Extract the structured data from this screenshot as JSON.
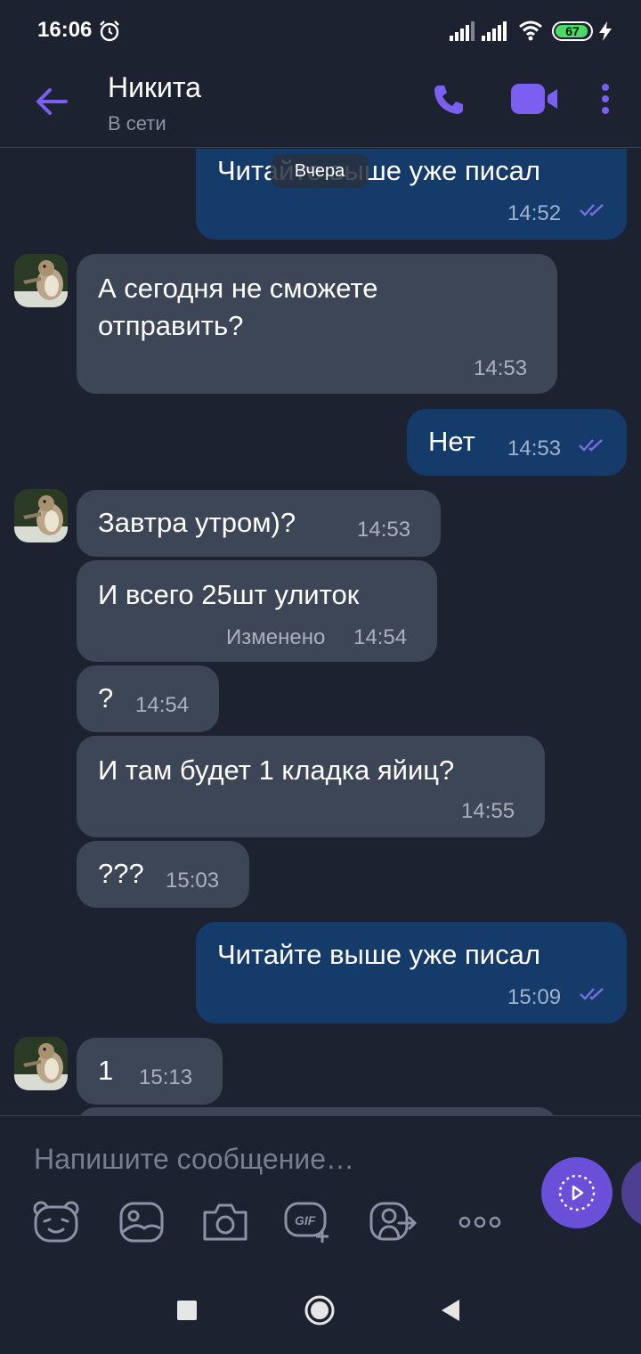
{
  "status_bar": {
    "time": "16:06",
    "battery": "67",
    "icons": [
      "alarm-icon",
      "signal-icon",
      "signal-icon",
      "wifi-icon",
      "battery-icon",
      "charging-bolt-icon"
    ]
  },
  "header": {
    "name": "Никита",
    "status": "В сети",
    "icons": [
      "back-arrow-icon",
      "phone-call-icon",
      "video-call-icon",
      "more-vertical-icon"
    ]
  },
  "date_separator": "Вчера",
  "messages": [
    {
      "dir": "out",
      "text": "Читайте выше уже писал",
      "time": "14:52",
      "read": true
    },
    {
      "dir": "in",
      "avatar": true,
      "line1": "А сегодня не сможете",
      "line2": "отправить?",
      "time": "14:53"
    },
    {
      "dir": "out",
      "text": "Нет",
      "time": "14:53",
      "read": true
    },
    {
      "dir": "in",
      "avatar": true,
      "text": "Завтра утром)?",
      "time": "14:53"
    },
    {
      "dir": "in",
      "text": "И всего 25шт улиток",
      "edited": "Изменено",
      "time": "14:54"
    },
    {
      "dir": "in",
      "text": "?",
      "time": "14:54"
    },
    {
      "dir": "in",
      "text": "И там будет 1 кладка яйиц?",
      "time": "14:55"
    },
    {
      "dir": "in",
      "text": "???",
      "time": "15:03"
    },
    {
      "dir": "out",
      "text": "Читайте выше уже писал",
      "time": "15:09",
      "read": true
    },
    {
      "dir": "in",
      "avatar": true,
      "text": "1",
      "time": "15:13"
    }
  ],
  "composer": {
    "placeholder": "Напишите сообщение…",
    "tools": [
      "sticker-icon",
      "gallery-icon",
      "camera-icon",
      "gif-icon",
      "contact-share-icon",
      "more-horizontal-icon"
    ],
    "gif_label": "GIF"
  },
  "colors": {
    "accent": "#6a4fd8",
    "incoming": "#3d4656",
    "outgoing": "#153b6b",
    "background": "#1c2230"
  }
}
